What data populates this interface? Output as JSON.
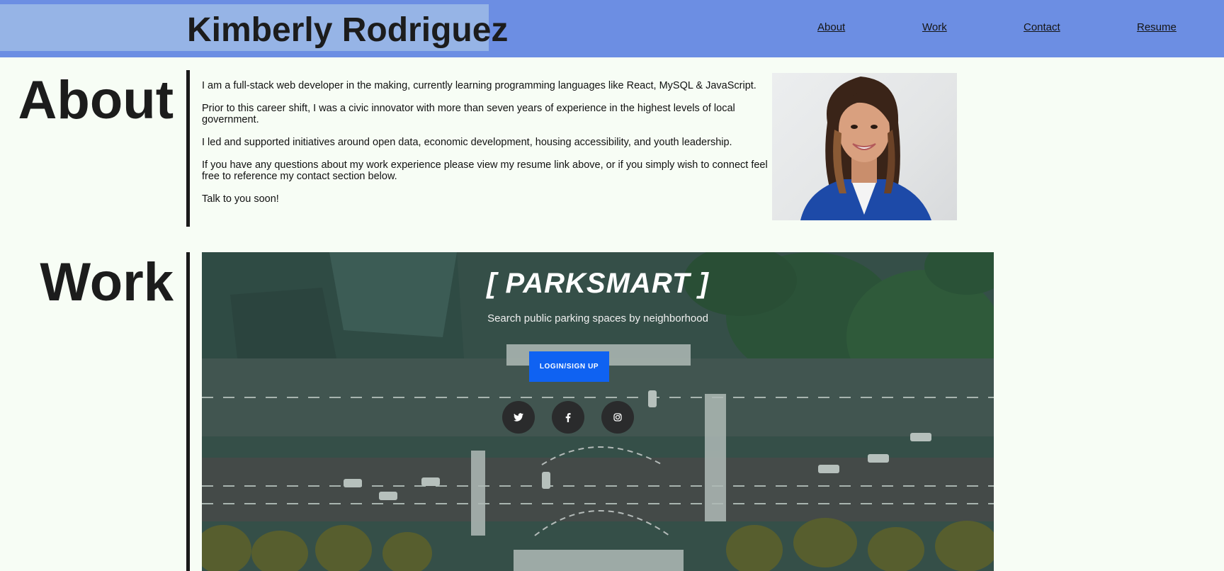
{
  "header": {
    "name": "Kimberly Rodriguez",
    "nav": [
      {
        "label": "About"
      },
      {
        "label": "Work"
      },
      {
        "label": "Contact"
      },
      {
        "label": "Resume"
      }
    ],
    "colors": {
      "bar": "#6c8ee3",
      "name_box": "#96b4e6"
    }
  },
  "about": {
    "heading": "About",
    "paragraphs": [
      "I am a full-stack web developer in the making, currently learning programming languages like React, MySQL & JavaScript.",
      "Prior to this career shift, I was a civic innovator with more than seven years of experience in the highest levels of local government.",
      "I led and supported initiatives around open data, economic development, housing accessibility, and youth leadership.",
      "If you have any questions about my work experience please view my resume link above, or if you simply wish to connect feel free to reference my contact section below.",
      "Talk to you soon!"
    ]
  },
  "work": {
    "heading": "Work",
    "project": {
      "title": "[ PARKSMART ]",
      "subtitle": "Search public parking spaces by neighborhood",
      "button_label": "LOGIN/SIGN UP",
      "button_color": "#0f62f2",
      "social_icons": [
        "twitter-icon",
        "facebook-icon",
        "instagram-icon"
      ]
    }
  }
}
